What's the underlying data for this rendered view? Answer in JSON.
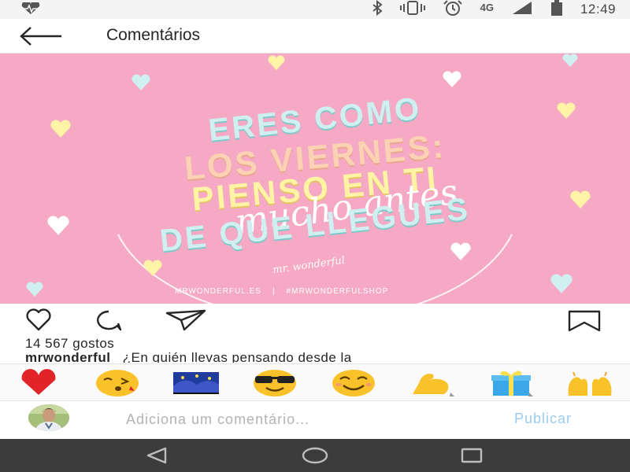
{
  "status_bar": {
    "network": "4G",
    "time": "12:49",
    "icons": [
      "heart-monitor-icon",
      "bluetooth-icon",
      "vibrate-icon",
      "alarm-icon",
      "signal-icon",
      "battery-icon"
    ]
  },
  "header": {
    "back_icon": "arrow-left-icon",
    "title": "Comentários"
  },
  "post": {
    "image": {
      "quote_line1": "ERES COMO",
      "quote_line2": "LOS VIERNES:",
      "quote_line3": "PIENSO EN TI",
      "quote_line4": "mucho antes",
      "quote_line5": "DE QUE LLEGUES",
      "signature": "mr. wonderful",
      "website": "MRWONDERFUL.ES",
      "separator": "|",
      "hashtag": "#MRWONDERFULSHOP",
      "background_color": "#f5a9c5"
    },
    "actions": [
      "heart-outline-icon",
      "comment-icon",
      "share-icon",
      "bookmark-icon"
    ],
    "likes": "14 567 gostos",
    "caption_user": "mrwonderful_",
    "caption_text": "¿En quién llevas pensando desde la"
  },
  "emoji_bar": {
    "items": [
      "red-heart-emoji",
      "kissing-face-emoji",
      "starry-night-emoji",
      "sunglasses-face-emoji",
      "smiling-face-emoji",
      "flexed-biceps-emoji",
      "gift-emoji",
      "raising-hands-emoji"
    ]
  },
  "comment_box": {
    "placeholder": "Adiciona um comentário...",
    "value": "",
    "publish_label": "Publicar",
    "publish_color": "#9ccbf0"
  },
  "nav_bar": {
    "buttons": [
      "back-triangle-icon",
      "home-circle-icon",
      "recents-square-icon"
    ]
  }
}
